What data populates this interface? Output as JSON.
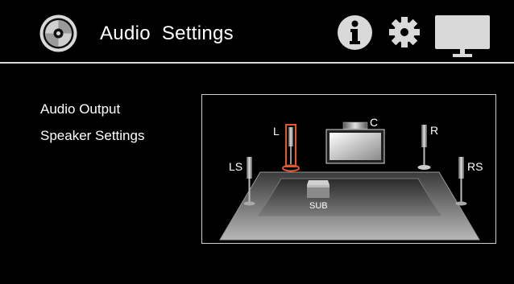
{
  "header": {
    "title": "Audio  Settings",
    "icons": [
      "disc-icon",
      "info-icon",
      "gear-icon",
      "display-icon"
    ]
  },
  "sidebar": {
    "items": [
      {
        "label": "Audio Output"
      },
      {
        "label": "Speaker Settings"
      }
    ]
  },
  "speaker_layout": {
    "speakers": [
      {
        "id": "L",
        "label": "L",
        "selected": true
      },
      {
        "id": "C",
        "label": "C",
        "selected": false
      },
      {
        "id": "R",
        "label": "R",
        "selected": false
      },
      {
        "id": "LS",
        "label": "LS",
        "selected": false
      },
      {
        "id": "RS",
        "label": "RS",
        "selected": false
      },
      {
        "id": "SUB",
        "label": "SUB",
        "selected": false
      }
    ]
  },
  "colors": {
    "background": "#000000",
    "text": "#ffffff",
    "selected_accent": "#e8562a",
    "divider": "#d8d8d8"
  }
}
